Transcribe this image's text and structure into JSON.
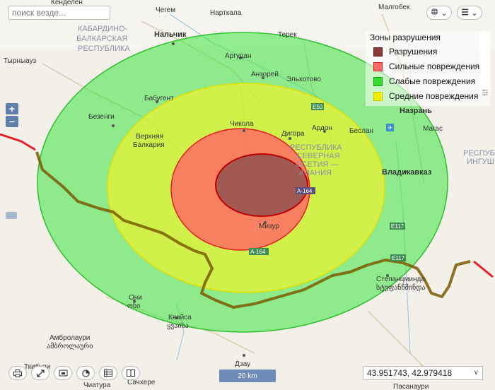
{
  "search": {
    "placeholder": "поиск везде..."
  },
  "map_labels": {
    "kendelen": "Кенделен",
    "chegem": "Чегем",
    "nartkala": "Нарткала",
    "malgobek": "Малгобек",
    "kbr": "КАБАРДИНО-",
    "kbr2": "БАЛКАРСКАЯ",
    "kbr3": "РЕСПУБЛИКА",
    "nalchik": "Нальчик",
    "terek": "Терек",
    "tyrnyauz": "Тырныауз",
    "argudan": "Аргудан",
    "anzorey": "Анзорей",
    "elkhotovo": "Эльхотово",
    "babugent": "Бабугент",
    "bezengi": "Безенги",
    "chikola": "Чикола",
    "digora": "Дигора",
    "ardon": "Ардон",
    "beslan": "Беслан",
    "nazran": "Назрань",
    "magas": "Магас",
    "ingush": "РЕСПУБЛ",
    "ingush2": "ИНГУШ",
    "vbalkaria": "Верхняя",
    "vbalkaria2": "Балкария",
    "rso": "РЕСПУБЛИКА",
    "rso2": "СЕВЕРНАЯ",
    "rso3": "ОСЕТИЯ —",
    "rso4": "АЛАНИЯ",
    "vladikavkaz": "Владикавказ",
    "mizur": "Мизур",
    "stepantsminda": "Степанцминда",
    "stepantsminda_ka": "სტეფანწმინდა",
    "oni": "Они",
    "oni_ka": "ონი",
    "kvaisa": "Квайса",
    "kvaisa_ka": "ყვაისა",
    "ambrolauri": "Амбролаури",
    "ambrolauri_ka": "ამბროლაური",
    "tkibuli": "Ткибули",
    "dzau": "Дзау",
    "chiatura": "Чиатура",
    "sachkhere": "Сачхере",
    "pasanauri": "Пасанаури",
    "r_e50": "E50",
    "r_a164": "A-164",
    "r_a164b": "A-164",
    "r_e117": "E117",
    "r_e117b": "E117"
  },
  "legend": {
    "title": "Зоны разрушения",
    "items": [
      {
        "label": "Разрушения",
        "color": "#8e3a3a"
      },
      {
        "label": "Сильные повреждения",
        "color": "#ff6b6b"
      },
      {
        "label": "Слабые повреждения",
        "color": "#33dd33"
      },
      {
        "label": "Средние повреждения",
        "color": "#f0f000"
      }
    ]
  },
  "scale": {
    "label": "20 km"
  },
  "coords": {
    "value": "43.951743, 42.979418"
  },
  "colors": {
    "border_line": "#7a5a00",
    "highway": "#e8202a"
  }
}
